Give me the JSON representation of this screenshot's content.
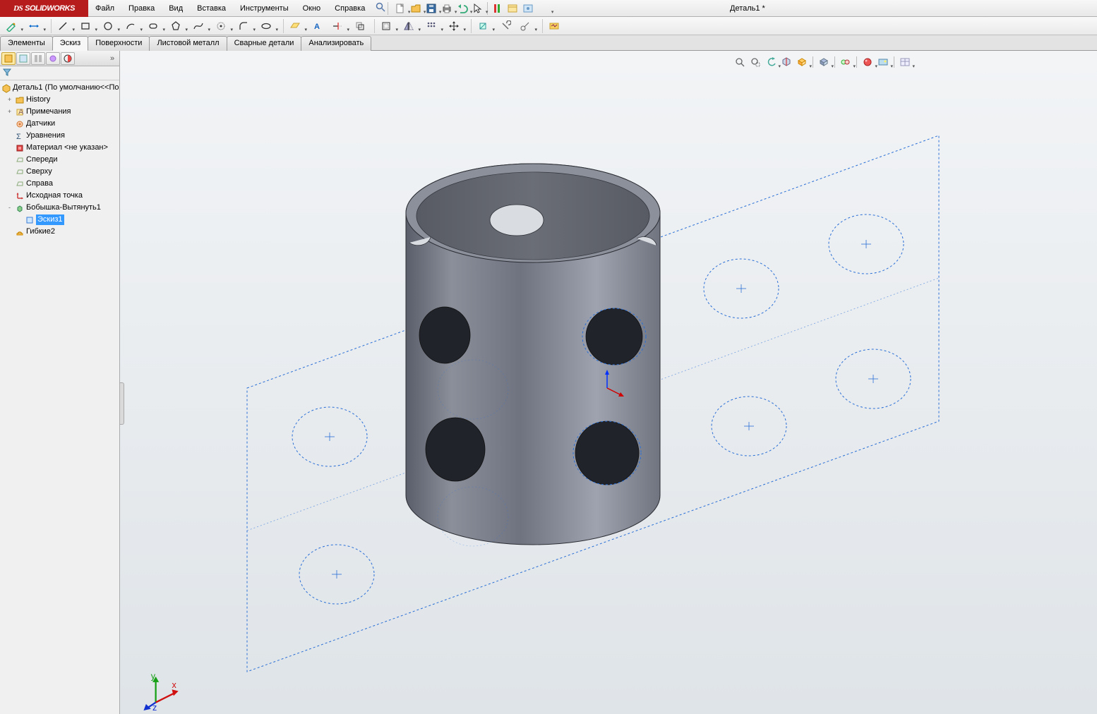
{
  "app": {
    "logo_prefix": "DS",
    "logo_text": "SOLIDWORKS",
    "title": "Деталь1 *"
  },
  "menu": [
    "Файл",
    "Правка",
    "Вид",
    "Вставка",
    "Инструменты",
    "Окно",
    "Справка"
  ],
  "tabs": [
    "Элементы",
    "Эскиз",
    "Поверхности",
    "Листовой металл",
    "Сварные детали",
    "Анализировать"
  ],
  "active_tab": "Эскиз",
  "tree": {
    "root": "Деталь1  (По умолчанию<<По",
    "items": [
      {
        "label": "History",
        "icon": "folder",
        "expand": "+",
        "depth": 1
      },
      {
        "label": "Примечания",
        "icon": "note",
        "expand": "+",
        "depth": 1
      },
      {
        "label": "Датчики",
        "icon": "sensor",
        "depth": 1
      },
      {
        "label": "Уравнения",
        "icon": "sigma",
        "depth": 1
      },
      {
        "label": "Материал <не указан>",
        "icon": "material",
        "depth": 1
      },
      {
        "label": "Спереди",
        "icon": "plane",
        "depth": 1
      },
      {
        "label": "Сверху",
        "icon": "plane",
        "depth": 1
      },
      {
        "label": "Справа",
        "icon": "plane",
        "depth": 1
      },
      {
        "label": "Исходная точка",
        "icon": "origin",
        "depth": 1
      },
      {
        "label": "Бобышка-Вытянуть1",
        "icon": "extrude",
        "expand": "-",
        "depth": 1
      },
      {
        "label": "Эскиз1",
        "icon": "sketch",
        "depth": 2,
        "selected": true
      },
      {
        "label": "Гибкие2",
        "icon": "flex",
        "depth": 1
      }
    ]
  },
  "triad_labels": {
    "x": "x",
    "y": "y",
    "z": "z"
  }
}
